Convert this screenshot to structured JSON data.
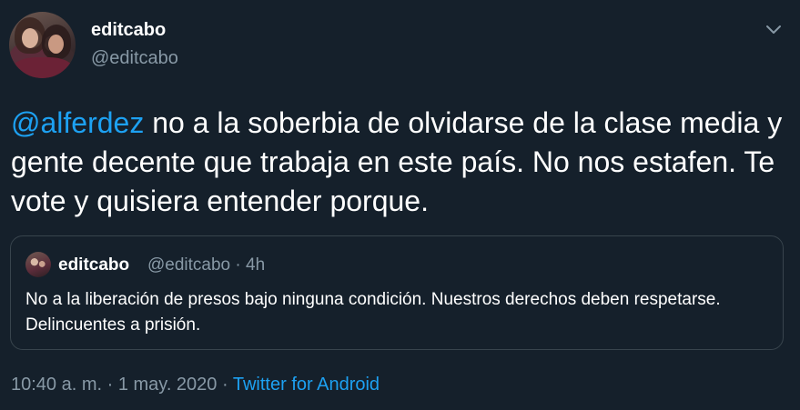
{
  "author": {
    "display_name": "editcabo",
    "handle": "@editcabo"
  },
  "tweet": {
    "mention": "@alferdez",
    "text": " no a la soberbia de olvidarse de la clase media y gente decente que trabaja en este país. No nos estafen. Te vote y quisiera entender porque."
  },
  "quoted_tweet": {
    "display_name": "editcabo",
    "handle": "@editcabo",
    "separator": " · ",
    "time_ago": "4h",
    "text": "No a la liberación de presos bajo ninguna condición. Nuestros derechos deben respetarse. Delincuentes a prisión."
  },
  "meta": {
    "time": "10:40 a. m.",
    "sep1": " · ",
    "date": "1 may. 2020",
    "sep2": " · ",
    "source": "Twitter for Android"
  },
  "icons": {
    "menu": "chevron-down-icon"
  },
  "colors": {
    "background": "#15202b",
    "link": "#1da1f2",
    "secondary_text": "#8899a6",
    "border": "#38444d"
  }
}
